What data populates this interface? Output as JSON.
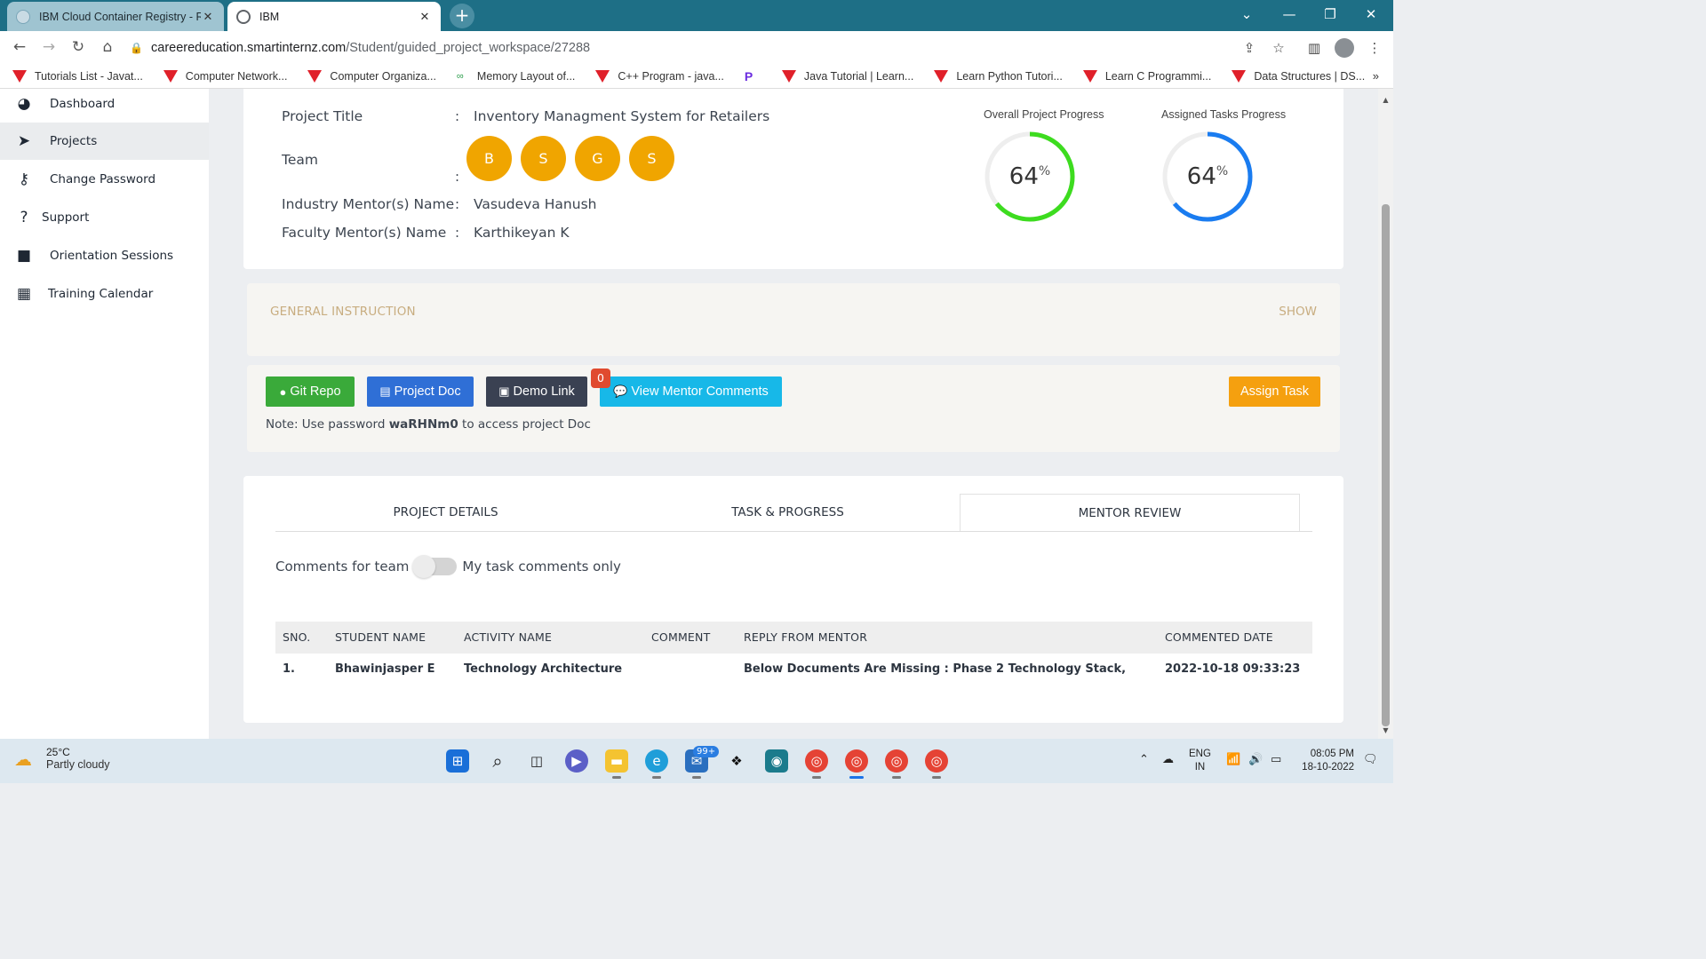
{
  "browser": {
    "tabs": [
      {
        "title": "IBM Cloud Container Registry - R",
        "active": false
      },
      {
        "title": "IBM",
        "active": true
      }
    ],
    "url_host": "careereducation.smartinternz.com",
    "url_path": "/Student/guided_project_workspace/27288",
    "bookmarks": [
      "Tutorials List - Javat...",
      "Computer Network...",
      "Computer Organiza...",
      "Memory Layout of...",
      "C++ Program - java...",
      "",
      "Java Tutorial | Learn...",
      "Learn Python Tutori...",
      "Learn C Programmi...",
      "Data Structures | DS..."
    ]
  },
  "sidebar": {
    "items": [
      {
        "label": "Dashboard",
        "icon": "palette-icon"
      },
      {
        "label": "Projects",
        "icon": "paper-plane-icon"
      },
      {
        "label": "Change Password",
        "icon": "key-icon"
      },
      {
        "label": "Support",
        "icon": "question-icon"
      },
      {
        "label": "Orientation Sessions",
        "icon": "video-camera-icon"
      },
      {
        "label": "Training Calendar",
        "icon": "calendar-icon"
      }
    ]
  },
  "project": {
    "title_label": "Project Title",
    "title_value": "Inventory Managment System for Retailers",
    "team_label": "Team",
    "team_initials": [
      "B",
      "S",
      "G",
      "S"
    ],
    "industry_label": "Industry Mentor(s) Name",
    "industry_value": "Vasudeva Hanush",
    "faculty_label": "Faculty Mentor(s) Name",
    "faculty_value": "Karthikeyan K",
    "colon": ":",
    "overall_title": "Overall Project Progress",
    "overall_value": "64",
    "overall_fraction": 0.64,
    "assigned_title": "Assigned Tasks Progress",
    "assigned_value": "64",
    "assigned_fraction": 0.64,
    "percent_sign": "%"
  },
  "instruction": {
    "title": "GENERAL INSTRUCTION",
    "toggle": "SHOW"
  },
  "actions": {
    "git": "Git Repo",
    "doc": "Project Doc",
    "demo": "Demo Link",
    "mentor_comments": "View Mentor Comments",
    "comment_count": "0",
    "assign": "Assign Task",
    "note_prefix": "Note: Use password ",
    "note_password": "waRHNm0",
    "note_suffix": " to access project Doc"
  },
  "tabs": {
    "items": [
      "PROJECT DETAILS",
      "TASK & PROGRESS",
      "MENTOR REVIEW"
    ],
    "active": "MENTOR REVIEW"
  },
  "review": {
    "toggle_left": "Comments for team",
    "toggle_right": "My task comments only",
    "columns": [
      "SNO.",
      "STUDENT NAME",
      "ACTIVITY NAME",
      "COMMENT",
      "REPLY FROM MENTOR",
      "COMMENTED DATE"
    ],
    "rows": [
      {
        "sno": "1.",
        "student": "Bhawinjasper E",
        "activity": "Technology Architecture",
        "comment": "",
        "reply": "Below Documents Are Missing : Phase 2 Technology Stack,",
        "date": "2022-10-18 09:33:23"
      }
    ]
  },
  "taskbar": {
    "temp": "25°C",
    "weather": "Partly cloudy",
    "mail_badge": "99+",
    "lang1": "ENG",
    "lang2": "IN",
    "time": "08:05 PM",
    "date": "18-10-2022"
  },
  "colors": {
    "overall_ring": "#3ddc1f",
    "assigned_ring": "#1a7cf0",
    "git": "#3aaa3a",
    "doc": "#2f6fd6",
    "demo": "#3a4152",
    "mentor": "#17b8e8",
    "assign": "#f5a00f"
  }
}
